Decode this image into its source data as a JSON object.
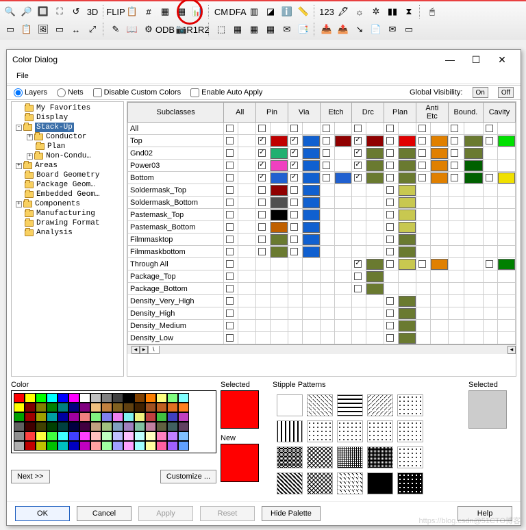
{
  "toolbar1": [
    "🔍",
    "🔎",
    "🔲",
    "⛶",
    "↺",
    "3D",
    "FLIP",
    "📋",
    "#",
    "▦",
    "▦",
    "📊",
    "CM",
    "DFA",
    "▥",
    "◪",
    "ℹ️",
    "📏",
    "123",
    "🖋",
    "☼",
    "✲",
    "▮▮",
    "⧗",
    "🖱"
  ],
  "toolbar2": [
    "▭",
    "📋",
    "🖼",
    "▭",
    "↔",
    "⤢",
    "✎",
    "📖",
    "⚙",
    "ODB",
    "📷",
    "R1R2",
    "⬚",
    "▦",
    "▦",
    "▦",
    "✉",
    "📑",
    "📥",
    "📤",
    "↘",
    "📄",
    "✉",
    "▭"
  ],
  "dialog": {
    "title": "Color Dialog",
    "menu": [
      "File"
    ],
    "radios": {
      "layers": "Layers",
      "nets": "Nets"
    },
    "checks": {
      "disable": "Disable Custom Colors",
      "auto": "Enable Auto Apply"
    },
    "globvis": "Global Visibility:",
    "on": "On",
    "off": "Off"
  },
  "tree": [
    {
      "lvl": 1,
      "exp": "",
      "t": "My Favorites"
    },
    {
      "lvl": 1,
      "exp": "",
      "t": "Display"
    },
    {
      "lvl": 1,
      "exp": "-",
      "t": "Stack-Up",
      "sel": true
    },
    {
      "lvl": 2,
      "exp": "+",
      "t": "Conductor"
    },
    {
      "lvl": 2,
      "exp": "",
      "t": "Plan"
    },
    {
      "lvl": 2,
      "exp": "+",
      "t": "Non-Condu…"
    },
    {
      "lvl": 1,
      "exp": "+",
      "t": "Areas"
    },
    {
      "lvl": 1,
      "exp": "",
      "t": "Board Geometry"
    },
    {
      "lvl": 1,
      "exp": "",
      "t": "Package Geom…"
    },
    {
      "lvl": 1,
      "exp": "",
      "t": "Embedded Geom…"
    },
    {
      "lvl": 1,
      "exp": "+",
      "t": "Components"
    },
    {
      "lvl": 1,
      "exp": "",
      "t": "Manufacturing"
    },
    {
      "lvl": 1,
      "exp": "",
      "t": "Drawing Format"
    },
    {
      "lvl": 1,
      "exp": "",
      "t": "Analysis"
    }
  ],
  "cols": [
    "Subclasses",
    "All",
    "Pin",
    "Via",
    "Etch",
    "Drc",
    "Plan",
    "Anti Etc",
    "Bound.",
    "Cavity"
  ],
  "rows": [
    {
      "n": "All",
      "cells": [
        {
          "k": 0,
          "ck": 0
        },
        {
          "k": 0,
          "ck": 0
        },
        {
          "k": 0,
          "ck": 0
        },
        {
          "k": 0,
          "ck": 0
        },
        {
          "k": 0,
          "ck": 0
        },
        {
          "k": 0,
          "ck": 0
        },
        {
          "k": 0,
          "ck": 0
        },
        {
          "k": 0,
          "ck": 0
        },
        {
          "k": 0,
          "ck": 0
        }
      ]
    },
    {
      "n": "Top",
      "cells": [
        {
          "k": 0,
          "ck": 0
        },
        {
          "k": 1,
          "ck": 1,
          "c": "#c00000"
        },
        {
          "k": 1,
          "ck": 1,
          "c": "#1060d0"
        },
        {
          "k": 1,
          "ck": 0,
          "c": "#900000"
        },
        {
          "k": 1,
          "ck": 1,
          "c": "#900000"
        },
        {
          "k": 1,
          "ck": 0,
          "c": "#e00000"
        },
        {
          "k": 1,
          "ck": 0,
          "c": "#e08000"
        },
        {
          "k": 1,
          "ck": 0,
          "c": "#6a7a30"
        },
        {
          "k": 1,
          "ck": 0,
          "c": "#00e000"
        }
      ]
    },
    {
      "n": "Gnd02",
      "cells": [
        {
          "k": 0,
          "ck": 0
        },
        {
          "k": 1,
          "ck": 1,
          "c": "#20b070"
        },
        {
          "k": 1,
          "ck": 1,
          "c": "#1060d0"
        },
        {
          "k": 0,
          "ck": 0
        },
        {
          "k": 1,
          "ck": 1,
          "c": "#6a7a30"
        },
        {
          "k": 1,
          "ck": 0,
          "c": "#6a7a30"
        },
        {
          "k": 1,
          "ck": 0,
          "c": "#e08000"
        },
        {
          "k": 1,
          "ck": 0,
          "c": "#6a7a30"
        },
        {
          "k": 2
        }
      ]
    },
    {
      "n": "Power03",
      "cells": [
        {
          "k": 0,
          "ck": 0
        },
        {
          "k": 1,
          "ck": 1,
          "c": "#f040c0"
        },
        {
          "k": 1,
          "ck": 1,
          "c": "#1060d0"
        },
        {
          "k": 0,
          "ck": 0
        },
        {
          "k": 1,
          "ck": 1,
          "c": "#6a7a30"
        },
        {
          "k": 1,
          "ck": 0,
          "c": "#6a7a30"
        },
        {
          "k": 1,
          "ck": 0,
          "c": "#e08000"
        },
        {
          "k": 1,
          "ck": 0,
          "c": "#006000"
        },
        {
          "k": 2
        }
      ]
    },
    {
      "n": "Bottom",
      "cells": [
        {
          "k": 0,
          "ck": 0
        },
        {
          "k": 1,
          "ck": 1,
          "c": "#2060d0"
        },
        {
          "k": 1,
          "ck": 1,
          "c": "#1060d0"
        },
        {
          "k": 1,
          "ck": 0,
          "c": "#2060d0"
        },
        {
          "k": 1,
          "ck": 1,
          "c": "#6a7a30"
        },
        {
          "k": 1,
          "ck": 0,
          "c": "#6a7a30"
        },
        {
          "k": 1,
          "ck": 0,
          "c": "#e08000"
        },
        {
          "k": 1,
          "ck": 0,
          "c": "#006000"
        },
        {
          "k": 1,
          "ck": 0,
          "c": "#f0e000"
        }
      ]
    },
    {
      "n": "Soldermask_Top",
      "cells": [
        {
          "k": 0,
          "ck": 0
        },
        {
          "k": 1,
          "ck": 0,
          "c": "#900000"
        },
        {
          "k": 1,
          "ck": 0,
          "c": "#1060d0"
        },
        {
          "k": 2
        },
        {
          "k": 2
        },
        {
          "k": 1,
          "ck": 0,
          "c": "#c8c850"
        },
        {
          "k": 2
        },
        {
          "k": 2
        },
        {
          "k": 2
        }
      ]
    },
    {
      "n": "Soldermask_Bottom",
      "cells": [
        {
          "k": 0,
          "ck": 0
        },
        {
          "k": 1,
          "ck": 0,
          "c": "#505050"
        },
        {
          "k": 1,
          "ck": 0,
          "c": "#1060d0"
        },
        {
          "k": 2
        },
        {
          "k": 2
        },
        {
          "k": 1,
          "ck": 0,
          "c": "#c8c850"
        },
        {
          "k": 2
        },
        {
          "k": 2
        },
        {
          "k": 2
        }
      ]
    },
    {
      "n": "Pastemask_Top",
      "cells": [
        {
          "k": 0,
          "ck": 0
        },
        {
          "k": 1,
          "ck": 0,
          "c": "#000000"
        },
        {
          "k": 1,
          "ck": 0,
          "c": "#1060d0"
        },
        {
          "k": 2
        },
        {
          "k": 2
        },
        {
          "k": 1,
          "ck": 0,
          "c": "#c8c850"
        },
        {
          "k": 2
        },
        {
          "k": 2
        },
        {
          "k": 2
        }
      ]
    },
    {
      "n": "Pastemask_Bottom",
      "cells": [
        {
          "k": 0,
          "ck": 0
        },
        {
          "k": 1,
          "ck": 0,
          "c": "#c06000"
        },
        {
          "k": 1,
          "ck": 0,
          "c": "#1060d0"
        },
        {
          "k": 2
        },
        {
          "k": 2
        },
        {
          "k": 1,
          "ck": 0,
          "c": "#c8c850"
        },
        {
          "k": 2
        },
        {
          "k": 2
        },
        {
          "k": 2
        }
      ]
    },
    {
      "n": "Filmmasktop",
      "cells": [
        {
          "k": 0,
          "ck": 0
        },
        {
          "k": 1,
          "ck": 0,
          "c": "#6a7a30"
        },
        {
          "k": 1,
          "ck": 0,
          "c": "#1060d0"
        },
        {
          "k": 2
        },
        {
          "k": 2
        },
        {
          "k": 1,
          "ck": 0,
          "c": "#6a7a30"
        },
        {
          "k": 2
        },
        {
          "k": 2
        },
        {
          "k": 2
        }
      ]
    },
    {
      "n": "Filmmaskbottom",
      "cells": [
        {
          "k": 0,
          "ck": 0
        },
        {
          "k": 1,
          "ck": 0,
          "c": "#6a7a30"
        },
        {
          "k": 1,
          "ck": 0,
          "c": "#1060d0"
        },
        {
          "k": 2
        },
        {
          "k": 2
        },
        {
          "k": 1,
          "ck": 0,
          "c": "#6a7a30"
        },
        {
          "k": 2
        },
        {
          "k": 2
        },
        {
          "k": 2
        }
      ]
    },
    {
      "n": "Through All",
      "cells": [
        {
          "k": 0,
          "ck": 0
        },
        {
          "k": 2
        },
        {
          "k": 2
        },
        {
          "k": 2
        },
        {
          "k": 1,
          "ck": 1,
          "c": "#6a7a30"
        },
        {
          "k": 1,
          "ck": 0,
          "c": "#c8c850"
        },
        {
          "k": 1,
          "ck": 0,
          "c": "#e08000"
        },
        {
          "k": 2
        },
        {
          "k": 1,
          "ck": 0,
          "c": "#008000"
        }
      ]
    },
    {
      "n": "Package_Top",
      "cells": [
        {
          "k": 0,
          "ck": 0
        },
        {
          "k": 2
        },
        {
          "k": 2
        },
        {
          "k": 2
        },
        {
          "k": 1,
          "ck": 0,
          "c": "#6a7a30"
        },
        {
          "k": 2
        },
        {
          "k": 2
        },
        {
          "k": 2
        },
        {
          "k": 2
        }
      ]
    },
    {
      "n": "Package_Bottom",
      "cells": [
        {
          "k": 0,
          "ck": 0
        },
        {
          "k": 2
        },
        {
          "k": 2
        },
        {
          "k": 2
        },
        {
          "k": 1,
          "ck": 0,
          "c": "#6a7a30"
        },
        {
          "k": 2
        },
        {
          "k": 2
        },
        {
          "k": 2
        },
        {
          "k": 2
        }
      ]
    },
    {
      "n": "Density_Very_High",
      "cells": [
        {
          "k": 0,
          "ck": 0
        },
        {
          "k": 2
        },
        {
          "k": 2
        },
        {
          "k": 2
        },
        {
          "k": 2
        },
        {
          "k": 1,
          "ck": 0,
          "c": "#6a7a30"
        },
        {
          "k": 2
        },
        {
          "k": 2
        },
        {
          "k": 2
        }
      ]
    },
    {
      "n": "Density_High",
      "cells": [
        {
          "k": 0,
          "ck": 0
        },
        {
          "k": 2
        },
        {
          "k": 2
        },
        {
          "k": 2
        },
        {
          "k": 2
        },
        {
          "k": 1,
          "ck": 0,
          "c": "#6a7a30"
        },
        {
          "k": 2
        },
        {
          "k": 2
        },
        {
          "k": 2
        }
      ]
    },
    {
      "n": "Density_Medium",
      "cells": [
        {
          "k": 0,
          "ck": 0
        },
        {
          "k": 2
        },
        {
          "k": 2
        },
        {
          "k": 2
        },
        {
          "k": 2
        },
        {
          "k": 1,
          "ck": 0,
          "c": "#6a7a30"
        },
        {
          "k": 2
        },
        {
          "k": 2
        },
        {
          "k": 2
        }
      ]
    },
    {
      "n": "Density_Low",
      "cells": [
        {
          "k": 0,
          "ck": 0
        },
        {
          "k": 2
        },
        {
          "k": 2
        },
        {
          "k": 2
        },
        {
          "k": 2
        },
        {
          "k": 1,
          "ck": 0,
          "c": "#6a7a30"
        },
        {
          "k": 2
        },
        {
          "k": 2
        },
        {
          "k": 2
        }
      ]
    }
  ],
  "palette": [
    "#ff0000",
    "#ffff00",
    "#00ff00",
    "#00ffff",
    "#0000ff",
    "#ff00ff",
    "#ffffff",
    "#c0c0c0",
    "#808080",
    "#404040",
    "#000000",
    "#804000",
    "#ff8000",
    "#ffff80",
    "#80ff80",
    "#80ffff",
    "#ffff00",
    "#800000",
    "#808000",
    "#008000",
    "#008080",
    "#000080",
    "#800080",
    "#f0c080",
    "#c08040",
    "#806020",
    "#604010",
    "#402000",
    "#a05020",
    "#c06020",
    "#e07020",
    "#ff8020",
    "#00a000",
    "#a00000",
    "#a0a000",
    "#00a0a0",
    "#0000a0",
    "#a000a0",
    "#f08080",
    "#80f080",
    "#8080f0",
    "#f080f0",
    "#80f0f0",
    "#f0f080",
    "#c04040",
    "#40c040",
    "#4040c0",
    "#c040c0",
    "#606060",
    "#400000",
    "#404000",
    "#004000",
    "#004040",
    "#000040",
    "#400040",
    "#c0a080",
    "#a0c080",
    "#80a0c0",
    "#a080c0",
    "#80c0a0",
    "#c080a0",
    "#606040",
    "#406060",
    "#604060",
    "#909090",
    "#ff4040",
    "#ffff40",
    "#40ff40",
    "#40ffff",
    "#4040ff",
    "#ff40ff",
    "#ffc0c0",
    "#c0ffc0",
    "#c0c0ff",
    "#ffc0ff",
    "#c0ffff",
    "#ffffc0",
    "#ff80c0",
    "#c080ff",
    "#80c0ff",
    "#b0b0b0",
    "#c00000",
    "#c0c000",
    "#00c000",
    "#00c0c0",
    "#0000c0",
    "#c000c0",
    "#ffa0a0",
    "#a0ffa0",
    "#a0a0ff",
    "#ffa0ff",
    "#a0ffff",
    "#ffffa0",
    "#ff60a0",
    "#a060ff",
    "#60a0ff"
  ],
  "lbl": {
    "color": "Color",
    "selected": "Selected",
    "new": "New",
    "stipple": "Stipple Patterns",
    "next": "Next >>",
    "customize": "Customize ..."
  },
  "btns": {
    "ok": "OK",
    "cancel": "Cancel",
    "apply": "Apply",
    "reset": "Reset",
    "hide": "Hide Palette",
    "help": "Help"
  },
  "watermark": "https://blog.csdn@51CTO博客"
}
